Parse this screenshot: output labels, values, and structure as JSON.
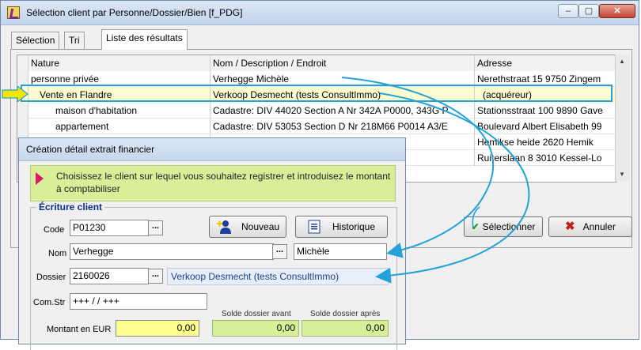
{
  "window": {
    "title": "Sélection client par Personne/Dossier/Bien [f_PDG]",
    "controls": {
      "minimize": "–",
      "maximize": "▢",
      "close": "✕"
    }
  },
  "tabs": [
    {
      "label": "Sélection",
      "active": false
    },
    {
      "label": "Tri",
      "active": false
    },
    {
      "label": "Liste des résultats",
      "active": true
    }
  ],
  "grid": {
    "columns": [
      "Nature",
      "Nom / Description / Endroit",
      "Adresse"
    ],
    "rows": [
      [
        "personne privée",
        "Verhegge Michèle",
        "Nerethstraat 15  9750 Zingem"
      ],
      [
        "Vente en Flandre",
        "Verkoop Desmecht (tests ConsultImmo)",
        "(acquéreur)"
      ],
      [
        "maison d'habitation",
        "Cadastre: DIV 44020  Section A  Nr 342A P0000, 343G P",
        "Stationsstraat 100  9890 Gave"
      ],
      [
        "appartement",
        "Cadastre: DIV 53053  Section D  Nr 218M66 P0014  A3/E",
        "Boulevard Albert Elisabeth 99"
      ],
      [
        "",
        "",
        "Hemikse heide    2620 Hemik"
      ],
      [
        "",
        "",
        "Ruiterslaan 8  3010 Kessel-Lo"
      ]
    ],
    "selected_row": 1
  },
  "buttons": {
    "select": "Sélectionner",
    "cancel": "Annuler"
  },
  "dialog": {
    "title": "Création détail extrait financier",
    "note": "Choisissez le client sur lequel vous souhaitez registrer et introduisez le montant à comptabiliser",
    "group": "Écriture client",
    "labels": {
      "code": "Code",
      "nom": "Nom",
      "dossier": "Dossier",
      "comstr": "Com.Str",
      "montant": "Montant en EUR",
      "solde_avant": "Solde dossier avant",
      "solde_apres": "Solde dossier après"
    },
    "values": {
      "code": "P01230",
      "nom": "Verhegge",
      "prenom": "Michèle",
      "dossier": "2160026",
      "dossier_desc": "Verkoop Desmecht (tests ConsultImmo)",
      "comstr": "+++  /  /   +++",
      "montant": "0,00",
      "solde_avant": "0,00",
      "solde_apres": "0,00"
    },
    "ellipsis": "...",
    "btn_nouveau": "Nouveau",
    "btn_historique": "Historique"
  },
  "colors": {
    "highlight": "#22a2d8",
    "selected_row": "#fffbd0",
    "note": "#d8ee98",
    "pointer": "#f5e600"
  }
}
